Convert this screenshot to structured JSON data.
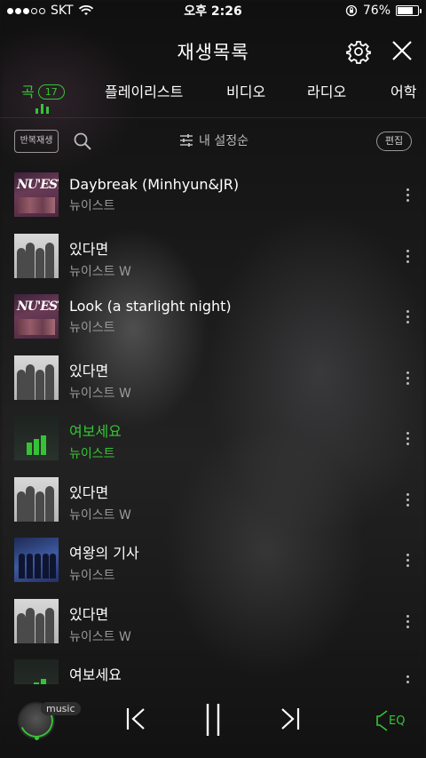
{
  "status_bar": {
    "carrier": "SKT",
    "time": "오후 2:26",
    "battery_text": "76%",
    "battery_level": 0.76
  },
  "header": {
    "title": "재생목록",
    "settings_icon": "gear-icon",
    "close_icon": "close-icon"
  },
  "tabs": [
    {
      "label": "곡",
      "badge": "17",
      "active": true
    },
    {
      "label": "플레이리스트"
    },
    {
      "label": "비디오"
    },
    {
      "label": "라디오"
    },
    {
      "label": "어학"
    }
  ],
  "toolbar": {
    "repeat_label": "반복재생",
    "sort_label": "내 설정순",
    "edit_label": "편집"
  },
  "tracks": [
    {
      "title": "Daybreak (Minhyun&JR)",
      "artist": "뉴이스트",
      "art": "nuest"
    },
    {
      "title": "있다면",
      "artist": "뉴이스트 W",
      "art": "w"
    },
    {
      "title": "Look (a starlight night)",
      "artist": "뉴이스트",
      "art": "nuest"
    },
    {
      "title": "있다면",
      "artist": "뉴이스트 W",
      "art": "w"
    },
    {
      "title": "여보세요",
      "artist": "뉴이스트",
      "art": "hello",
      "playing": true
    },
    {
      "title": "있다면",
      "artist": "뉴이스트 W",
      "art": "w"
    },
    {
      "title": "여왕의 기사",
      "artist": "뉴이스트",
      "art": "queen"
    },
    {
      "title": "있다면",
      "artist": "뉴이스트 W",
      "art": "w"
    },
    {
      "title": "여보세요",
      "artist": "",
      "art": "hello"
    }
  ],
  "album_logo_text": "NU'EST",
  "player": {
    "app_label": "music",
    "eq_label": "EQ"
  },
  "colors": {
    "accent": "#35c535"
  }
}
